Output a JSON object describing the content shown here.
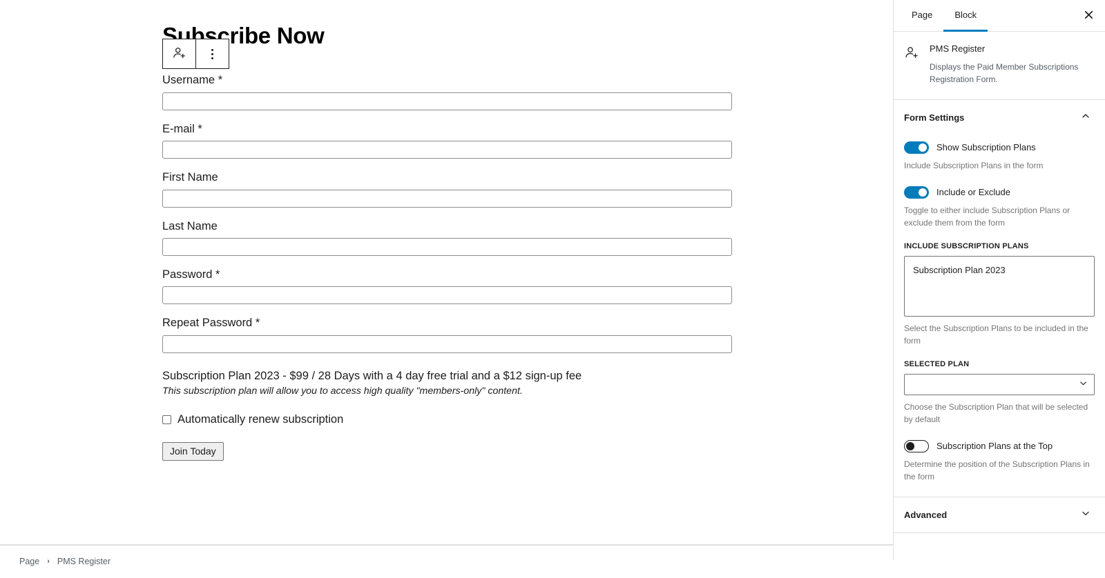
{
  "editor": {
    "page_title": "Subscribe Now",
    "block_toolbar": {
      "block_icon_name": "person-add-icon",
      "options_label": "Options"
    },
    "form": {
      "fields": [
        {
          "label": "Username",
          "required": true,
          "value": "",
          "placeholder": ""
        },
        {
          "label": "E-mail",
          "required": true,
          "value": "",
          "placeholder": ""
        },
        {
          "label": "First Name",
          "required": false,
          "value": "",
          "placeholder": ""
        },
        {
          "label": "Last Name",
          "required": false,
          "value": "",
          "placeholder": ""
        },
        {
          "label": "Password",
          "required": true,
          "value": "",
          "placeholder": ""
        },
        {
          "label": "Repeat Password",
          "required": true,
          "value": "",
          "placeholder": ""
        }
      ],
      "required_marker": "*",
      "plan_title": "Subscription Plan 2023 - $99 / 28 Days with a 4 day free trial and a $12 sign-up fee",
      "plan_description": "This subscription plan will allow you to access high quality \"members-only\" content.",
      "auto_renew_label": "Automatically renew subscription",
      "auto_renew_checked": false,
      "submit_label": "Join Today"
    }
  },
  "breadcrumb": {
    "items": [
      "Page",
      "PMS Register"
    ],
    "separator": "›"
  },
  "sidebar": {
    "tabs": [
      {
        "label": "Page",
        "active": false
      },
      {
        "label": "Block",
        "active": true
      }
    ],
    "close_label": "Close settings",
    "block": {
      "name": "PMS Register",
      "description": "Displays the Paid Member Subscriptions Registration Form.",
      "icon_name": "person-add-icon"
    },
    "form_settings": {
      "title": "Form Settings",
      "expanded": true,
      "toggles": [
        {
          "label": "Show Subscription Plans",
          "on": true,
          "help": "Include Subscription Plans in the form"
        },
        {
          "label": "Include or Exclude",
          "on": true,
          "help": "Toggle to either include Subscription Plans or exclude them from the form"
        }
      ],
      "include_plans": {
        "label": "Include Subscription Plans",
        "options": [
          "Subscription Plan 2023"
        ],
        "help": "Select the Subscription Plans to be included in the form"
      },
      "selected_plan": {
        "label": "Selected Plan",
        "value": "",
        "help": "Choose the Subscription Plan that will be selected by default"
      },
      "plans_top_toggle": {
        "label": "Subscription Plans at the Top",
        "on": false,
        "help": "Determine the position of the Subscription Plans in the form"
      }
    },
    "advanced": {
      "title": "Advanced",
      "expanded": false
    }
  },
  "colors": {
    "accent": "#007cba",
    "border": "#e0e0e0",
    "text": "#1e1e1e",
    "muted": "#757575"
  }
}
